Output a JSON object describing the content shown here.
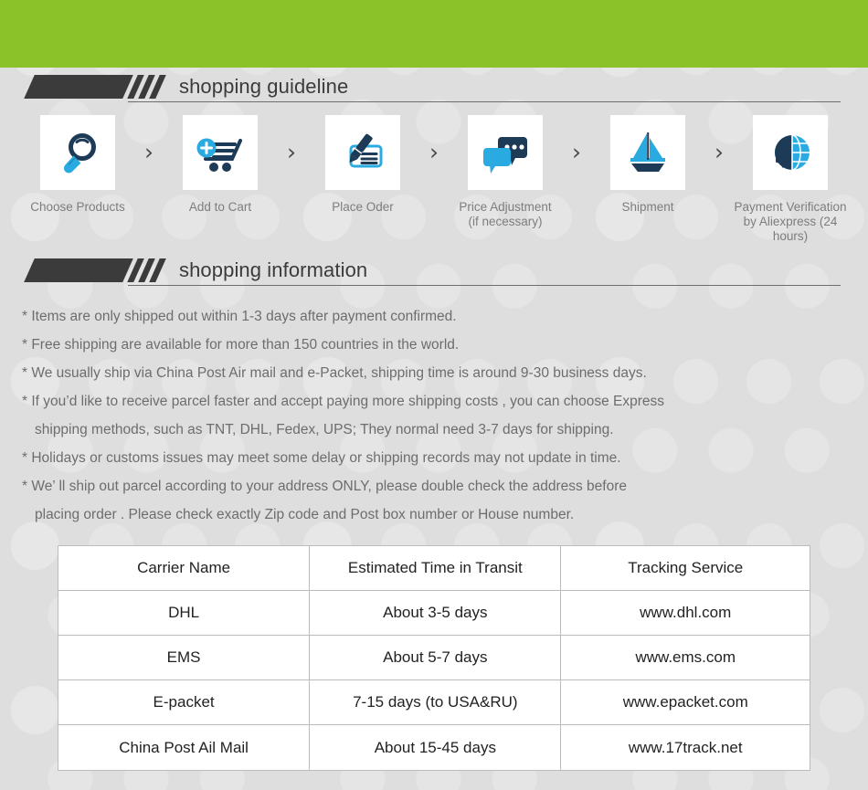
{
  "theme": {
    "banner_color": "#8CC229",
    "page_background": "#DEDEDE",
    "heading_color": "#3B3B3B",
    "body_text_color": "#6D6D6D",
    "icon_dark": "#1D3A56",
    "icon_light": "#29ABE2"
  },
  "sections": {
    "guideline": {
      "title": "shopping guideline"
    },
    "information": {
      "title": "shopping information"
    }
  },
  "steps": [
    {
      "icon": "magnifier-icon",
      "label": "Choose Products"
    },
    {
      "icon": "add-to-cart-icon",
      "label": "Add to Cart"
    },
    {
      "icon": "pen-document-icon",
      "label": "Place Oder"
    },
    {
      "icon": "chat-bubbles-icon",
      "label": "Price Adjustment\n(if necessary)"
    },
    {
      "icon": "sailboat-icon",
      "label": "Shipment"
    },
    {
      "icon": "dollar-globe-icon",
      "label": "Payment Verification\nby  Aliexpress (24 hours)"
    }
  ],
  "step_arrow": "›",
  "info_lines": [
    {
      "text": "* Items are only shipped out within 1-3 days after payment confirmed.",
      "continuation": false
    },
    {
      "text": "* Free shipping are available for more than 150 countries in the world.",
      "continuation": false
    },
    {
      "text": "* We usually ship via China Post Air mail and e-Packet, shipping time is around 9-30 business days.",
      "continuation": false
    },
    {
      "text": "* If you’d like to receive parcel faster and accept paying more shipping costs , you can choose Express",
      "continuation": false
    },
    {
      "text": "shipping methods, such as TNT, DHL, Fedex, UPS; They normal need 3-7 days for shipping.",
      "continuation": true
    },
    {
      "text": "* Holidays or customs issues may meet some delay or shipping records may not update in time.",
      "continuation": false
    },
    {
      "text": "* We’ ll ship out parcel according to your address ONLY, please double check the address before",
      "continuation": false
    },
    {
      "text": "placing order . Please check exactly Zip code and Post box number or House number.",
      "continuation": true
    }
  ],
  "carrier_table": {
    "headers": [
      "Carrier Name",
      "Estimated Time in Transit",
      "Tracking Service"
    ],
    "rows": [
      [
        "DHL",
        "About 3-5 days",
        "www.dhl.com"
      ],
      [
        "EMS",
        "About 5-7 days",
        "www.ems.com"
      ],
      [
        "E-packet",
        "7-15 days (to USA&RU)",
        "www.epacket.com"
      ],
      [
        "China Post Ail Mail",
        "About 15-45 days",
        "www.17track.net"
      ]
    ]
  }
}
